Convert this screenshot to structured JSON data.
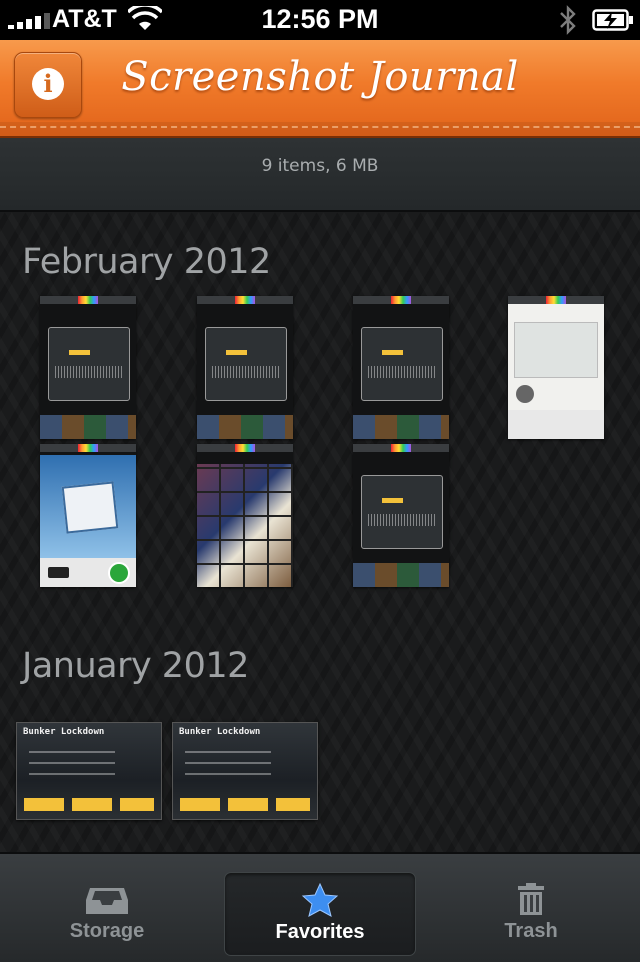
{
  "status_bar": {
    "carrier": "AT&T",
    "time": "12:56 PM"
  },
  "header": {
    "title": "Screenshot Journal",
    "info_icon": "i"
  },
  "summary": {
    "text": "9 items, 6  MB"
  },
  "sections": [
    {
      "title": "February 2012",
      "thumbnails": [
        {
          "kind": "game-over-stats"
        },
        {
          "kind": "game-over-stats"
        },
        {
          "kind": "game-over-stats"
        },
        {
          "kind": "photos-liked-profile"
        },
        {
          "kind": "photos-liked-sign"
        },
        {
          "kind": "photo-grid"
        },
        {
          "kind": "game-over-stats"
        }
      ]
    },
    {
      "title": "January 2012",
      "thumbnails": [
        {
          "kind": "bunker-lockdown",
          "title": "Bunker Lockdown"
        },
        {
          "kind": "bunker-lockdown",
          "title": "Bunker Lockdown"
        }
      ]
    }
  ],
  "tabbar": {
    "tabs": [
      {
        "label": "Storage",
        "icon": "inbox-tray-icon",
        "selected": false
      },
      {
        "label": "Favorites",
        "icon": "star-icon",
        "selected": true
      },
      {
        "label": "Trash",
        "icon": "trash-can-icon",
        "selected": false
      }
    ]
  },
  "colors": {
    "header_orange": "#f07a2a",
    "favorites_star": "#3d8ef0",
    "background_dark": "#1b1c1d"
  }
}
